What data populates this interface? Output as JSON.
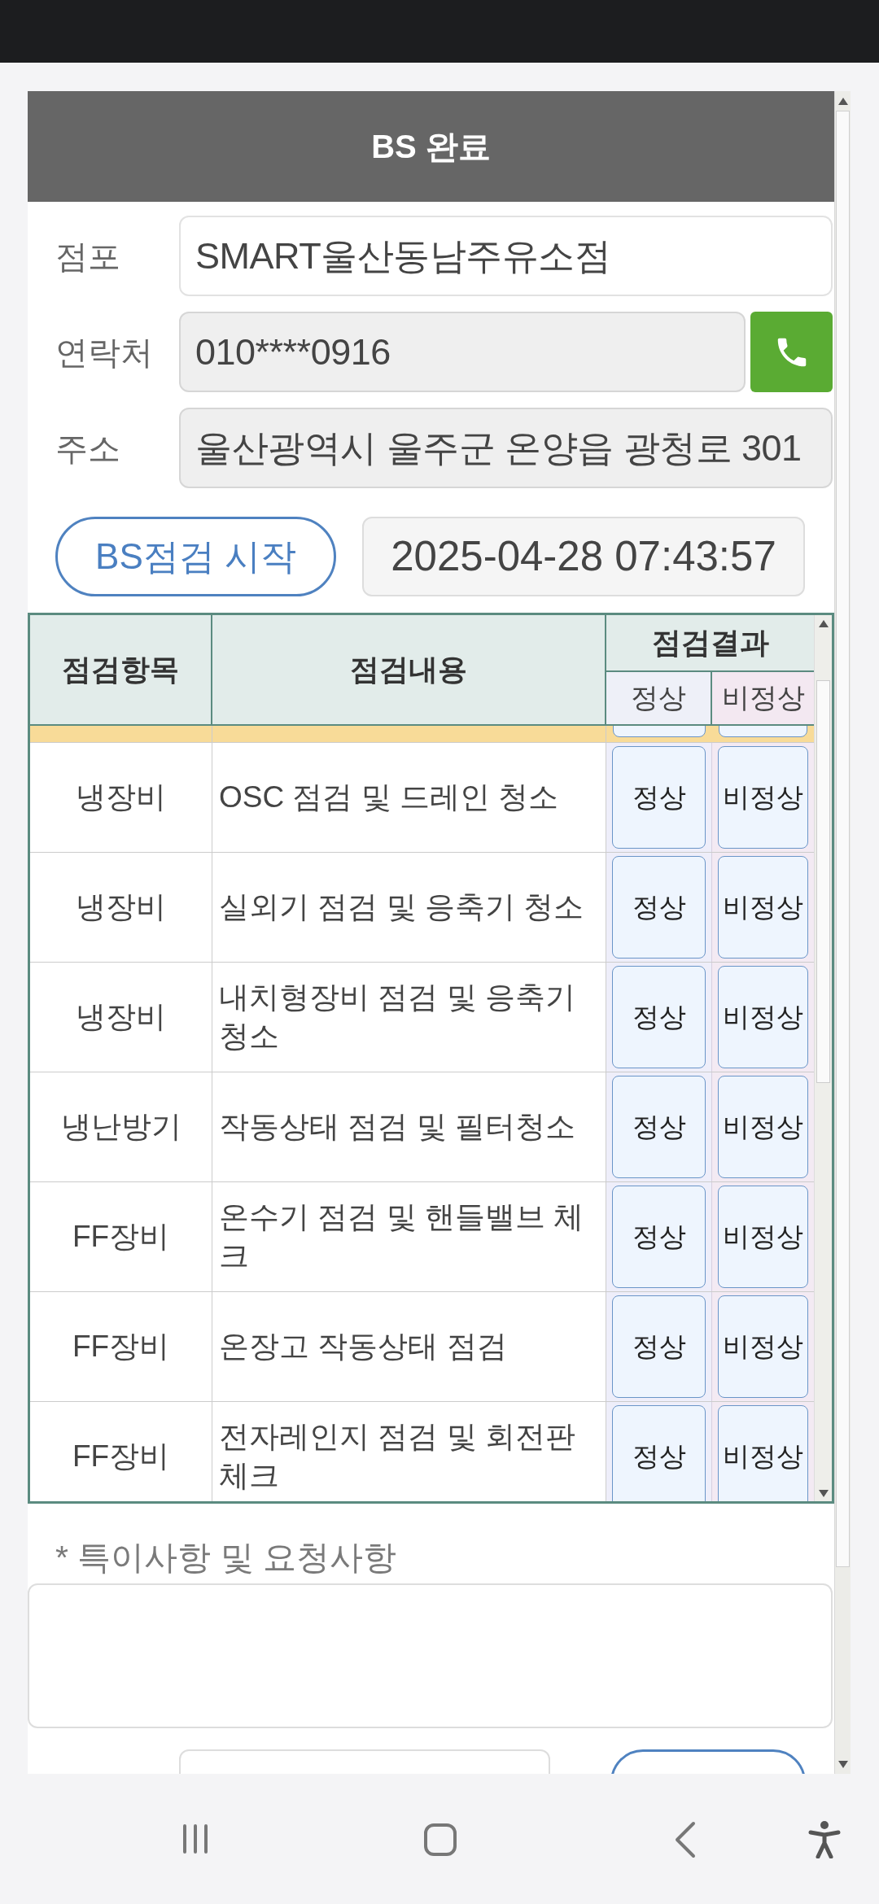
{
  "header": {
    "title": "BS 완료"
  },
  "form": [
    {
      "label": "점포",
      "value": "SMART울산동남주유소점",
      "kind": "text",
      "readonly": false
    },
    {
      "label": "연락처",
      "value": "010****0916",
      "kind": "phone",
      "readonly": true
    },
    {
      "label": "주소",
      "value": "울산광역시 울주군 온양읍 광청로 301",
      "kind": "text",
      "readonly": true
    }
  ],
  "start_button": "BS점검 시작",
  "timestamp": "2025-04-28 07:43:57",
  "table": {
    "columns": [
      "점검항목",
      "점검내용"
    ],
    "result_header": "점검결과",
    "result_columns": [
      "정상",
      "비정상"
    ],
    "rows": [
      {
        "category": "냉장비",
        "content": "OSC 점검 및 드레인 청소",
        "buttons": [
          "정상",
          "비정상"
        ]
      },
      {
        "category": "냉장비",
        "content": "실외기 점검 및 응축기 청소",
        "buttons": [
          "정상",
          "비정상"
        ]
      },
      {
        "category": "냉장비",
        "content": "내치형장비 점검 및 응축기 청소",
        "buttons": [
          "정상",
          "비정상"
        ]
      },
      {
        "category": "냉난방기",
        "content": "작동상태 점검 및 필터청소",
        "buttons": [
          "정상",
          "비정상"
        ]
      },
      {
        "category": "FF장비",
        "content": "온수기 점검 및 핸들밸브 체크",
        "buttons": [
          "정상",
          "비정상"
        ]
      },
      {
        "category": "FF장비",
        "content": "온장고 작동상태 점검",
        "buttons": [
          "정상",
          "비정상"
        ]
      },
      {
        "category": "FF장비",
        "content": "전자레인지 점검 및 회전판 체크",
        "buttons": [
          "정상",
          "비정상"
        ]
      }
    ]
  },
  "note_label": "* 특이사항 및 요청사항"
}
